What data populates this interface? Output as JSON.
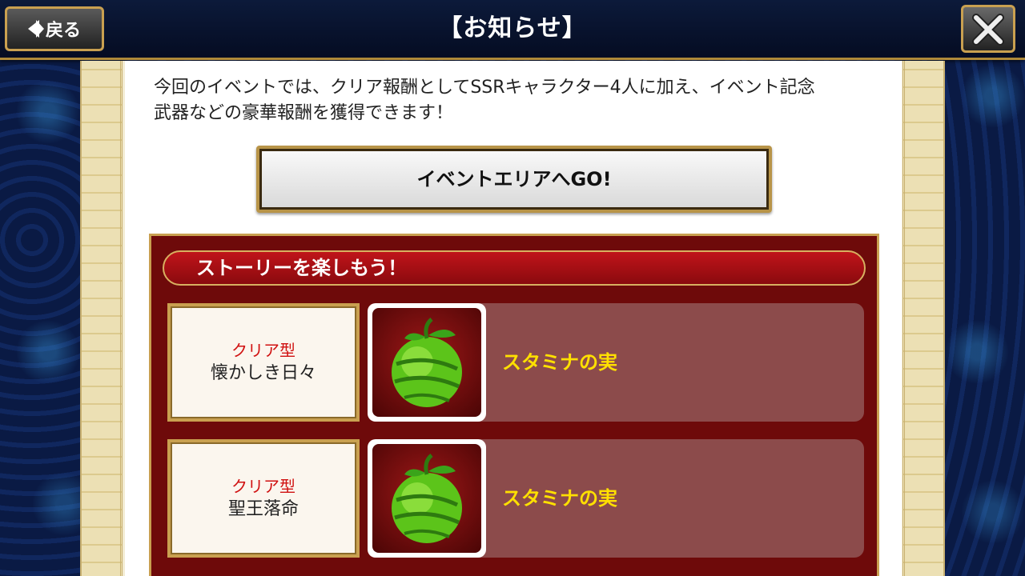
{
  "header": {
    "title": "【お知らせ】",
    "back_label": "戻る"
  },
  "content": {
    "intro_line1": "今回のイベントでは、クリア報酬としてSSRキャラクター4人に加え、イベント記念",
    "intro_line2": "武器などの豪華報酬を獲得できます！",
    "go_button": "イベントエリアへGO!",
    "story": {
      "banner": "ストーリーを楽しもう！",
      "rows": [
        {
          "type": "クリア型",
          "title": "懐かしき日々",
          "reward": "スタミナの実",
          "icon": "melon-icon"
        },
        {
          "type": "クリア型",
          "title": "聖王落命",
          "reward": "スタミナの実",
          "icon": "melon-icon"
        }
      ]
    }
  },
  "colors": {
    "header_bg": "#0c1a3a",
    "gold_border": "#c9a050",
    "story_bg": "#6e0a0a",
    "item_row_bg": "#8c4b4b",
    "reward_text": "#ffe000",
    "type_text": "#d01010"
  }
}
